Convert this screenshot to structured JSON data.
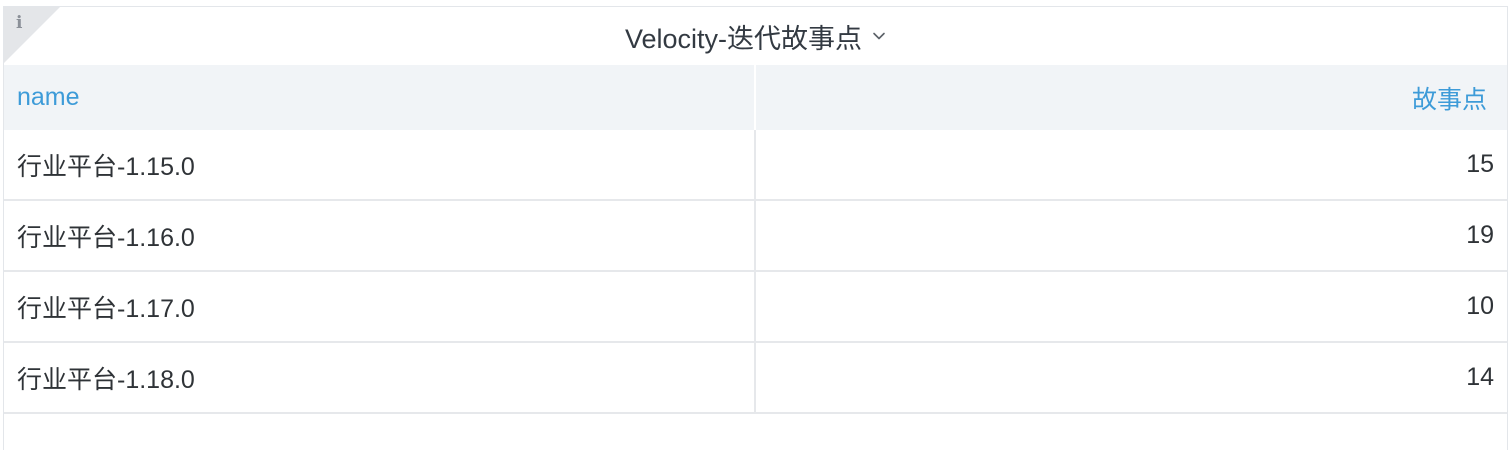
{
  "panel": {
    "title": "Velocity-迭代故事点",
    "info_icon_glyph": "i"
  },
  "table": {
    "columns": [
      "name",
      "故事点"
    ],
    "rows": [
      {
        "name": "行业平台-1.15.0",
        "points": "15"
      },
      {
        "name": "行业平台-1.16.0",
        "points": "19"
      },
      {
        "name": "行业平台-1.17.0",
        "points": "10"
      },
      {
        "name": "行业平台-1.18.0",
        "points": "14"
      }
    ]
  },
  "colors": {
    "header_text": "#3d9bd8",
    "header_bg": "#f1f4f7",
    "body_text": "#2f3337",
    "border": "#e6e8eb"
  },
  "icons": [
    "info-icon",
    "chevron-down-icon"
  ]
}
